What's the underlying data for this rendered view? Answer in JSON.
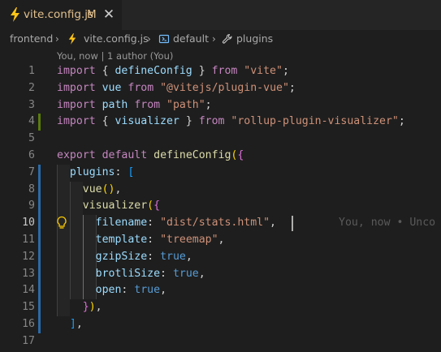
{
  "tab": {
    "title": "vite.config.js",
    "status": "M",
    "close_glyph": "✕",
    "icon": "vite-icon",
    "status_color": "#e2c08d"
  },
  "breadcrumb": {
    "items": [
      "frontend",
      "vite.config.js",
      "default",
      "plugins"
    ],
    "separator": "›"
  },
  "codelens": "You, now | 1 author (You)",
  "editor": {
    "line_numbers": [
      "1",
      "2",
      "3",
      "4",
      "5",
      "6",
      "7",
      "8",
      "9",
      "10",
      "11",
      "12",
      "13",
      "14",
      "15",
      "16",
      "17"
    ],
    "active_line": "10",
    "blame_text": "You, now • Unco",
    "lines": [
      [
        [
          "import",
          "kw"
        ],
        [
          " { ",
          "pun"
        ],
        [
          "defineConfig",
          "var"
        ],
        [
          " } ",
          "pun"
        ],
        [
          "from",
          "kw"
        ],
        [
          " ",
          "pun"
        ],
        [
          "\"vite\"",
          "str"
        ],
        [
          ";",
          "pun"
        ]
      ],
      [
        [
          "import",
          "kw"
        ],
        [
          " ",
          "pun"
        ],
        [
          "vue",
          "var"
        ],
        [
          " ",
          "pun"
        ],
        [
          "from",
          "kw"
        ],
        [
          " ",
          "pun"
        ],
        [
          "\"@vitejs/plugin-vue\"",
          "str"
        ],
        [
          ";",
          "pun"
        ]
      ],
      [
        [
          "import",
          "kw"
        ],
        [
          " ",
          "pun"
        ],
        [
          "path",
          "var"
        ],
        [
          " ",
          "pun"
        ],
        [
          "from",
          "kw"
        ],
        [
          " ",
          "pun"
        ],
        [
          "\"path\"",
          "str"
        ],
        [
          ";",
          "pun"
        ]
      ],
      [
        [
          "import",
          "kw"
        ],
        [
          " { ",
          "pun"
        ],
        [
          "visualizer",
          "var"
        ],
        [
          " } ",
          "pun"
        ],
        [
          "from",
          "kw"
        ],
        [
          " ",
          "pun"
        ],
        [
          "\"rollup-plugin-visualizer\"",
          "str"
        ],
        [
          ";",
          "pun"
        ]
      ],
      [],
      [
        [
          "export",
          "kw"
        ],
        [
          " ",
          "pun"
        ],
        [
          "default",
          "kw"
        ],
        [
          " ",
          "pun"
        ],
        [
          "defineConfig",
          "fn"
        ],
        [
          "(",
          "br1"
        ],
        [
          "{",
          "br2"
        ]
      ],
      [
        [
          "  ",
          "pun"
        ],
        [
          "plugins",
          "var"
        ],
        [
          ": ",
          "pun"
        ],
        [
          "[",
          "br3"
        ]
      ],
      [
        [
          "    ",
          "pun"
        ],
        [
          "vue",
          "fn"
        ],
        [
          "(",
          "br1"
        ],
        [
          ")",
          "br1"
        ],
        [
          ",",
          "pun"
        ]
      ],
      [
        [
          "    ",
          "pun"
        ],
        [
          "visualizer",
          "fn"
        ],
        [
          "(",
          "br1"
        ],
        [
          "{",
          "br2"
        ]
      ],
      [
        [
          "      ",
          "pun"
        ],
        [
          "filename",
          "var"
        ],
        [
          ": ",
          "pun"
        ],
        [
          "\"dist/stats.html\"",
          "str"
        ],
        [
          ",",
          "pun"
        ]
      ],
      [
        [
          "      ",
          "pun"
        ],
        [
          "template",
          "var"
        ],
        [
          ": ",
          "pun"
        ],
        [
          "\"treemap\"",
          "str"
        ],
        [
          ",",
          "pun"
        ]
      ],
      [
        [
          "      ",
          "pun"
        ],
        [
          "gzipSize",
          "var"
        ],
        [
          ": ",
          "pun"
        ],
        [
          "true",
          "kwb"
        ],
        [
          ",",
          "pun"
        ]
      ],
      [
        [
          "      ",
          "pun"
        ],
        [
          "brotliSize",
          "var"
        ],
        [
          ": ",
          "pun"
        ],
        [
          "true",
          "kwb"
        ],
        [
          ",",
          "pun"
        ]
      ],
      [
        [
          "      ",
          "pun"
        ],
        [
          "open",
          "var"
        ],
        [
          ": ",
          "pun"
        ],
        [
          "true",
          "kwb"
        ],
        [
          ",",
          "pun"
        ]
      ],
      [
        [
          "    ",
          "pun"
        ],
        [
          "}",
          "br2"
        ],
        [
          ")",
          "br1"
        ],
        [
          ",",
          "pun"
        ]
      ],
      [
        [
          "  ",
          "pun"
        ],
        [
          "]",
          "br3"
        ],
        [
          ",",
          "pun"
        ]
      ],
      []
    ]
  }
}
